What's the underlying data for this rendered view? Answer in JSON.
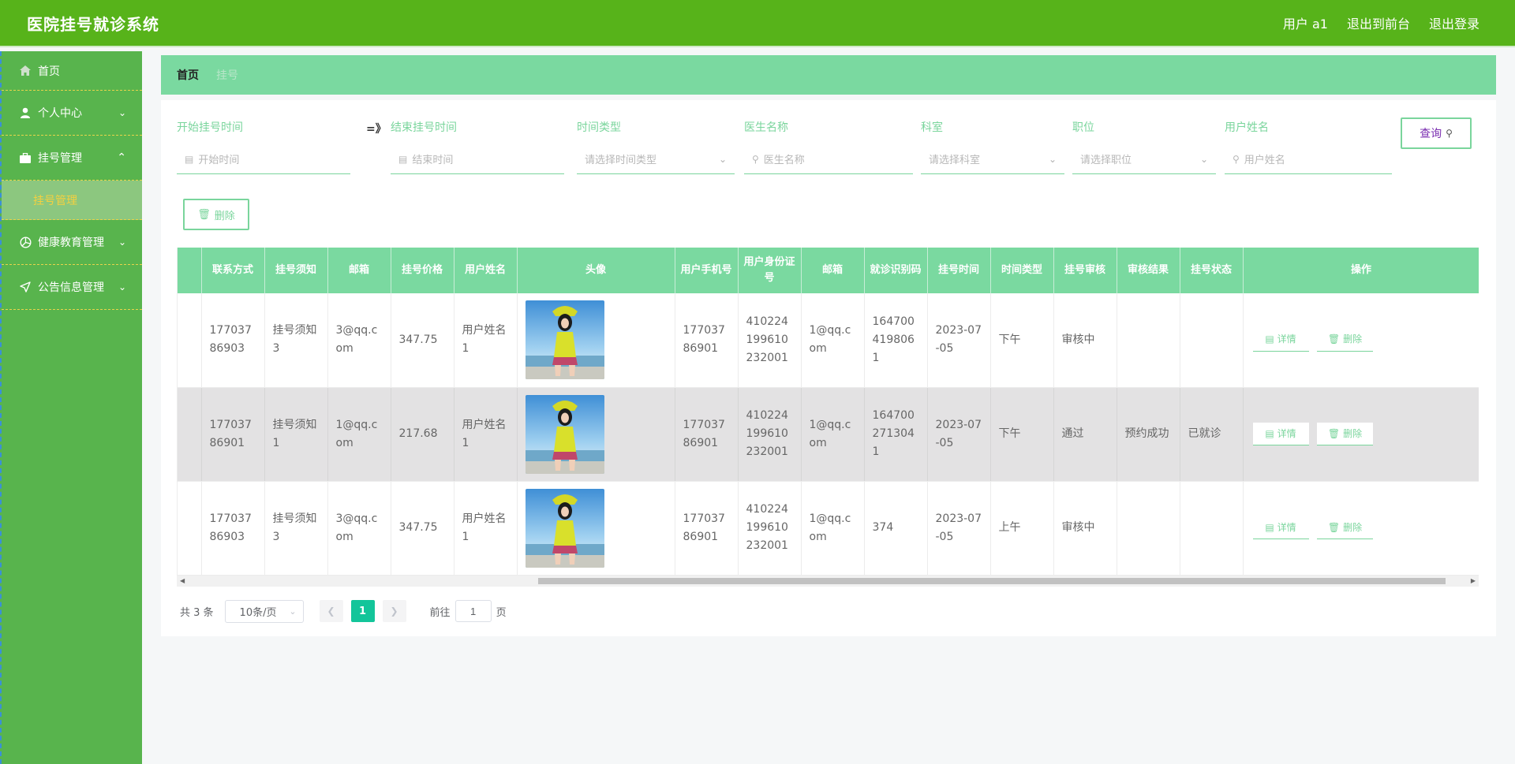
{
  "header": {
    "title": "医院挂号就诊系统",
    "user_label": "用户 a1",
    "front_link": "退出到前台",
    "logout_link": "退出登录"
  },
  "sidebar": {
    "items": [
      {
        "label": "首页",
        "icon": "home-icon"
      },
      {
        "label": "个人中心",
        "icon": "user-icon"
      },
      {
        "label": "挂号管理",
        "icon": "briefcase-icon",
        "expanded": true
      },
      {
        "label": "健康教育管理",
        "icon": "aperture-icon"
      },
      {
        "label": "公告信息管理",
        "icon": "send-icon"
      }
    ],
    "sub_item": "挂号管理"
  },
  "breadcrumb": {
    "home": "首页",
    "current": "挂号"
  },
  "filters": {
    "start_label": "开始挂号时间",
    "start_placeholder": "开始时间",
    "range_sep": "=》",
    "end_label": "结束挂号时间",
    "end_placeholder": "结束时间",
    "timetype_label": "时间类型",
    "timetype_placeholder": "请选择时间类型",
    "doctor_label": "医生名称",
    "doctor_placeholder": "医生名称",
    "dept_label": "科室",
    "dept_placeholder": "请选择科室",
    "title_label": "职位",
    "title_placeholder": "请选择职位",
    "username_label": "用户姓名",
    "username_placeholder": "用户姓名",
    "search_button": "查询",
    "delete_button": "删除"
  },
  "table": {
    "columns": [
      "联系方式",
      "挂号须知",
      "邮箱",
      "挂号价格",
      "用户姓名",
      "头像",
      "用户手机号",
      "用户身份证号",
      "邮箱",
      "就诊识别码",
      "挂号时间",
      "时间类型",
      "挂号审核",
      "审核结果",
      "挂号状态",
      "操作"
    ],
    "rows": [
      {
        "contact": "17703786903",
        "notice": "挂号须知3",
        "email": "3@qq.com",
        "price": "347.75",
        "username": "用户姓名1",
        "phone": "17703786901",
        "idcard": "410224199610232001",
        "email2": "1@qq.com",
        "code": "1647004198061",
        "time": "2023-07-05",
        "timetype": "下午",
        "review": "审核中",
        "result": "",
        "status": ""
      },
      {
        "contact": "17703786901",
        "notice": "挂号须知1",
        "email": "1@qq.com",
        "price": "217.68",
        "username": "用户姓名1",
        "phone": "17703786901",
        "idcard": "410224199610232001",
        "email2": "1@qq.com",
        "code": "1647002713041",
        "time": "2023-07-05",
        "timetype": "下午",
        "review": "通过",
        "result": "预约成功",
        "status": "已就诊"
      },
      {
        "contact": "17703786903",
        "notice": "挂号须知3",
        "email": "3@qq.com",
        "price": "347.75",
        "username": "用户姓名1",
        "phone": "17703786901",
        "idcard": "410224199610232001",
        "email2": "1@qq.com",
        "code": "374",
        "time": "2023-07-05",
        "timetype": "上午",
        "review": "审核中",
        "result": "",
        "status": ""
      }
    ],
    "detail_button": "详情",
    "delete_button": "删除"
  },
  "pagination": {
    "total": "共 3 条",
    "page_size": "10条/页",
    "current_page": "1",
    "goto_prefix": "前往",
    "goto_value": "1",
    "goto_suffix": "页"
  },
  "colors": {
    "header_green": "#57b31a",
    "sidebar_green": "#58b44d",
    "accent_mint": "#7ad9a0",
    "page_active": "#13c59a"
  }
}
